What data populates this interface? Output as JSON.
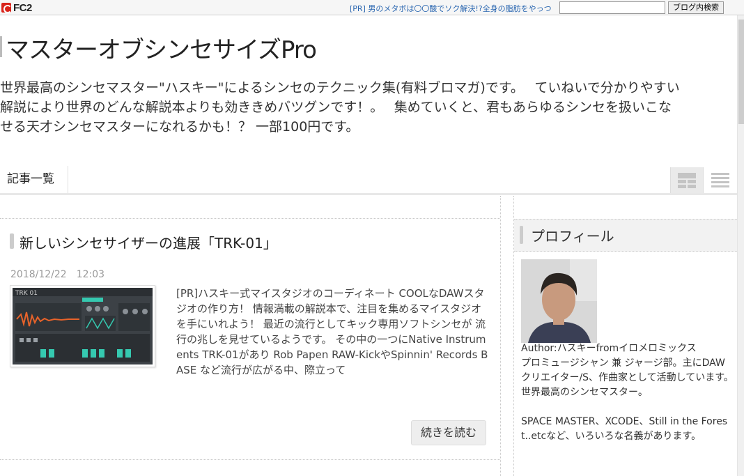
{
  "topbar": {
    "logo_text": "FC2",
    "pr_link": "[PR] 男のメタボは〇〇酸でソク解決!?全身の脂肪をやっつ",
    "search_value": "",
    "search_button": "ブログ内検索"
  },
  "header": {
    "title": "マスターオブシンセサイズPro",
    "description_lines": [
      "世界最高のシンセマスター\"ハスキー\"によるシンセのテクニック集(有料ブロマガ)です。　 ていねいで分かりやすい",
      "解説により世界のどんな解説本よりも効ききめバツグンです！。　 集めていくと、君もあらゆるシンセを扱いこな",
      "せる天才シンセマスターになれるかも！？ 一部100円です。"
    ]
  },
  "nav": {
    "tab_label": "記事一覧",
    "view_grid_icon": "grid-view-icon",
    "view_list_icon": "list-view-icon"
  },
  "article": {
    "title": "新しいシンセサイザーの進展「TRK-01」",
    "date": "2018/12/22　12:03",
    "thumbnail_text": "TRK 01",
    "body": "[PR]ハスキー式マイスタジオのコーディネート COOLなDAWスタジオの作り方！ 情報満載の解説本で、注目を集めるマイスタジオを手にいれよう！ 最近の流行としてキック専用ソフトシンセが 流行の兆しを見せているようです。 その中の一つにNative Instruments TRK-01があり Rob Papen RAW-KickやSpinnin' Records BASE など流行が広がる中、際立って",
    "more_button": "続きを読む"
  },
  "sidebar": {
    "profile_title": "プロフィール",
    "profile_lines": [
      "Author:ハスキーfromイロメロミックス",
      "プロミュージシャン 兼 ジャージ部。主にDAWクリエイター/S、作曲家として活動しています。",
      "世界最高のシンセマスター。",
      "",
      "SPACE MASTER、XCODE、Still in the Forest..etcなど、いろいろな名義があります。"
    ]
  },
  "colors": {
    "link": "#2a66b0",
    "accent_teal": "#35c9b0",
    "accent_orange": "#e8632a"
  }
}
